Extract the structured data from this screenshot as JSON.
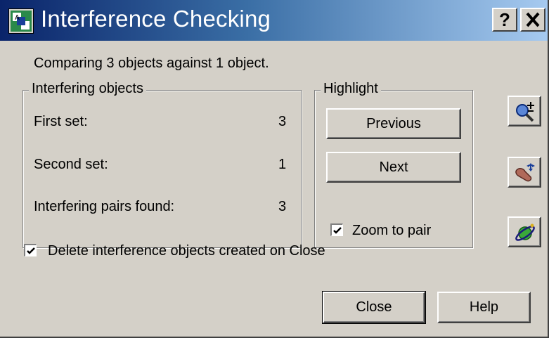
{
  "window": {
    "title": "Interference Checking",
    "help_button": "?",
    "close_button": "✕"
  },
  "summary": "Comparing 3 objects against 1 object.",
  "interfering_objects": {
    "legend": "Interfering objects",
    "rows": [
      {
        "label": "First set:",
        "value": "3"
      },
      {
        "label": "Second set:",
        "value": "1"
      },
      {
        "label": "Interfering pairs found:",
        "value": "3"
      }
    ]
  },
  "highlight": {
    "legend": "Highlight",
    "previous": "Previous",
    "next": "Next",
    "zoom_to_pair": "Zoom to pair",
    "zoom_to_pair_checked": true
  },
  "side_tools": {
    "icons": [
      "zoom-realtime-icon",
      "pan-icon",
      "orbit-icon"
    ]
  },
  "delete_option": {
    "label": "Delete interference objects created on Close",
    "checked": true
  },
  "footer": {
    "close": "Close",
    "help": "Help"
  },
  "colors": {
    "title_start": "#0a246a",
    "title_end": "#a6caf0",
    "dialog_bg": "#d4d0c8"
  }
}
